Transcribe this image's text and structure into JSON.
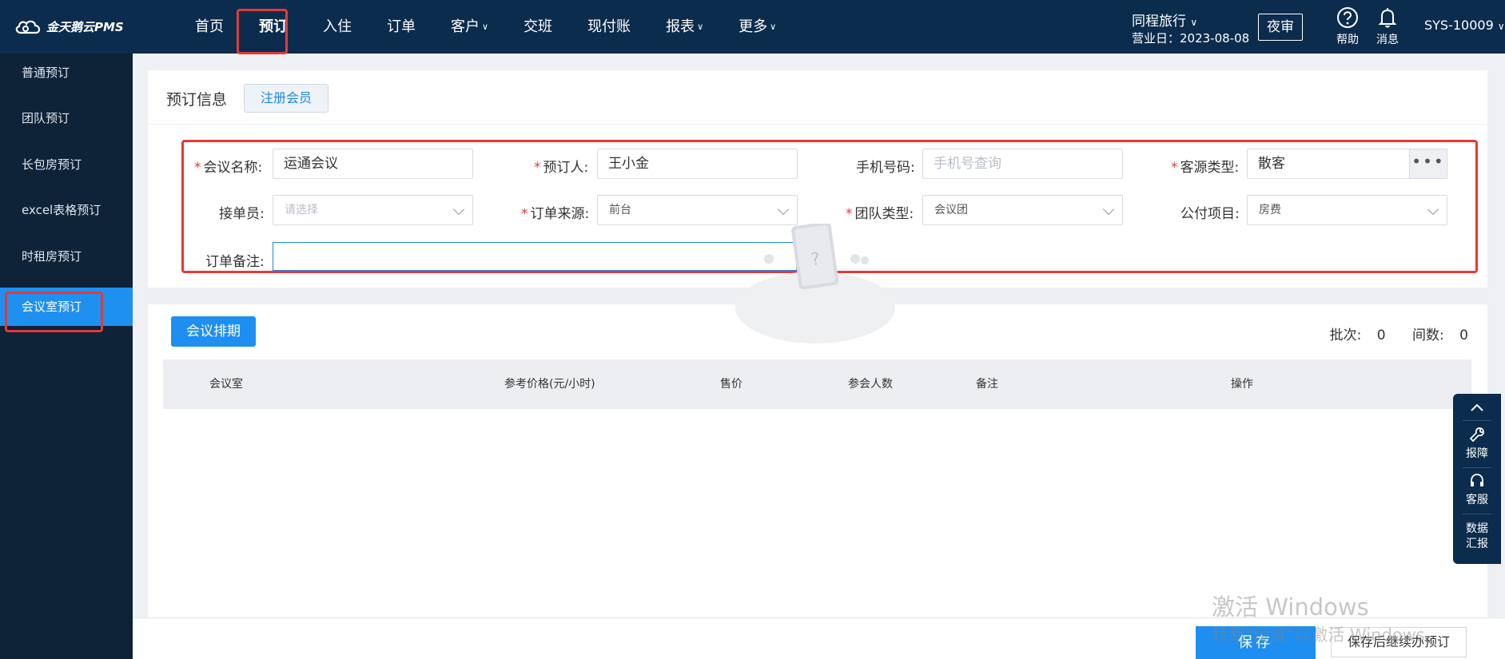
{
  "app": {
    "logo_text": "金天鹅云PMS"
  },
  "nav": {
    "items": [
      {
        "label": "首页",
        "caret": false
      },
      {
        "label": "预订",
        "caret": false,
        "active": true
      },
      {
        "label": "入住",
        "caret": false
      },
      {
        "label": "订单",
        "caret": false
      },
      {
        "label": "客户",
        "caret": true
      },
      {
        "label": "交班",
        "caret": false
      },
      {
        "label": "现付账",
        "caret": false
      },
      {
        "label": "报表",
        "caret": true
      },
      {
        "label": "更多",
        "caret": true
      }
    ],
    "hotel_name": "同程旅行",
    "business_date": "营业日：2023-08-08",
    "night_audit": "夜审",
    "help": "帮助",
    "messages": "消息",
    "user": "SYS-10009"
  },
  "sidebar": {
    "items": [
      {
        "label": "普通预订"
      },
      {
        "label": "团队预订"
      },
      {
        "label": "长包房预订"
      },
      {
        "label": "excel表格预订"
      },
      {
        "label": "时租房预订"
      },
      {
        "label": "会议室预订",
        "active": true
      }
    ]
  },
  "booking_info": {
    "title": "预订信息",
    "register_member": "注册会员",
    "fields": {
      "meeting_name": {
        "label": "会议名称:",
        "value": "运通会议",
        "required": true
      },
      "booker": {
        "label": "预订人:",
        "value": "王小金",
        "required": true
      },
      "phone": {
        "label": "手机号码:",
        "placeholder": "手机号查询",
        "required": false
      },
      "source_type": {
        "label": "客源类型:",
        "value": "散客",
        "required": true,
        "more": "•••"
      },
      "receiver": {
        "label": "接单员:",
        "placeholder": "请选择",
        "required": false
      },
      "order_source": {
        "label": "订单来源:",
        "value": "前台",
        "required": true
      },
      "group_type": {
        "label": "团队类型:",
        "value": "会议团",
        "required": true
      },
      "public_item": {
        "label": "公付项目:",
        "value": "房费",
        "required": false
      },
      "remark": {
        "label": "订单备注:",
        "value": ""
      }
    }
  },
  "schedule": {
    "button": "会议排期",
    "batch_label": "批次:",
    "batch_value": "0",
    "rooms_label": "间数:",
    "rooms_value": "0",
    "columns": [
      "会议室",
      "参考价格(元/小时)",
      "售价",
      "参会人数",
      "备注",
      "操作"
    ]
  },
  "float_panel": {
    "report_issue": "报障",
    "service": "客服",
    "data_report_1": "数据",
    "data_report_2": "汇报"
  },
  "footer": {
    "save": "保存",
    "save_continue": "保存后继续办预订"
  },
  "watermark": {
    "line1": "激活 Windows",
    "line2": "转到\"设置\"以激活 Windows。"
  },
  "colors": {
    "topbar": "#0c2c4d",
    "sidebar": "#0e2238",
    "accent": "#1e8ef0",
    "highlight": "#e53935"
  }
}
